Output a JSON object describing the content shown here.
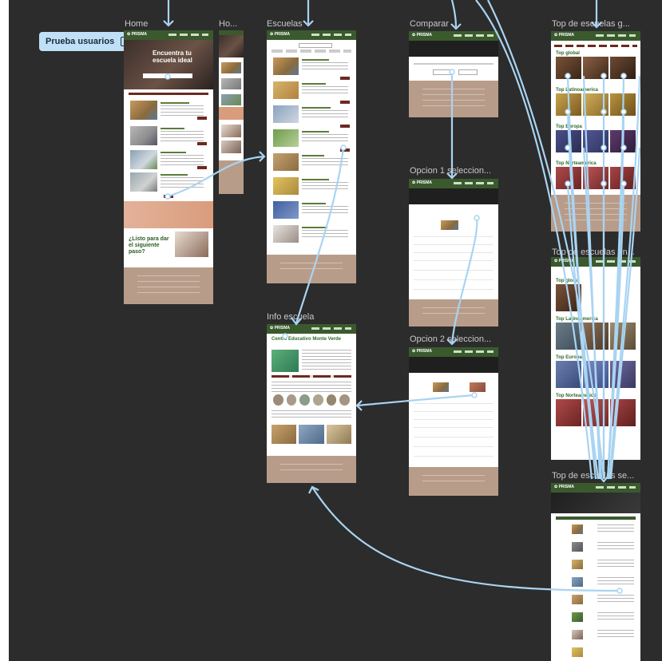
{
  "prototype": {
    "flow_button_label": "Prueba usuarios",
    "flow_button_icon": "play-icon"
  },
  "frames": {
    "home": {
      "label": "Home",
      "hero_title": "Encuentra tu escuela ideal",
      "cta_title": "¿Listo para dar el siguiente paso?"
    },
    "home_mobile": {
      "label": "Ho..."
    },
    "escuelas": {
      "label": "Escuelas"
    },
    "comparar": {
      "label": "Comparar"
    },
    "opcion1": {
      "label": "Opcion 1 seleccion..."
    },
    "opcion2": {
      "label": "Opcion 2 seleccion..."
    },
    "info_escuela": {
      "label": "Info escuela",
      "school_name": "Centro Educativo Monte Verde"
    },
    "top_grid": {
      "label": "Top de escuelas g...",
      "sections": [
        "Top global",
        "Top Latinoamerica",
        "Top Europa",
        "Top Norteamerica"
      ]
    },
    "top_list": {
      "label": "Top de escuelas en...",
      "sections": [
        "Top global",
        "Top Latinoamerica",
        "Top Europa",
        "Top Norteamerica"
      ]
    },
    "top_table": {
      "label": "Top de escuelas se..."
    }
  },
  "colors": {
    "canvas": "#2c2c2c",
    "nav": "#3a5a2e",
    "footer": "#b89c8a",
    "accent_button": "#6b2a1e",
    "connector": "#a9d4f2",
    "flow_badge": "#bfe0f7"
  }
}
